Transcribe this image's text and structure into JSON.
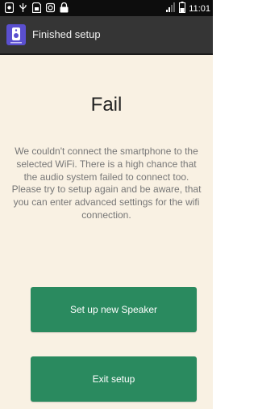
{
  "status_bar": {
    "time": "11:01",
    "icons": [
      "notification-icon",
      "usb-icon",
      "sd-card-icon",
      "image-icon",
      "lock-icon",
      "signal-icon",
      "battery-icon"
    ]
  },
  "action_bar": {
    "title": "Finished setup",
    "app_icon": "speaker-app-icon"
  },
  "main": {
    "headline": "Fail",
    "message": "We couldn't connect the smartphone to the selected WiFi. There is a high chance that the audio system failed to connect too. Please try to setup again and be aware, that you can enter advanced settings for the wifi connection.",
    "primary_button": "Set up new Speaker",
    "secondary_button": "Exit setup"
  },
  "colors": {
    "background": "#f9f1e3",
    "button": "#2a8a5f",
    "action_bar": "#353535"
  }
}
